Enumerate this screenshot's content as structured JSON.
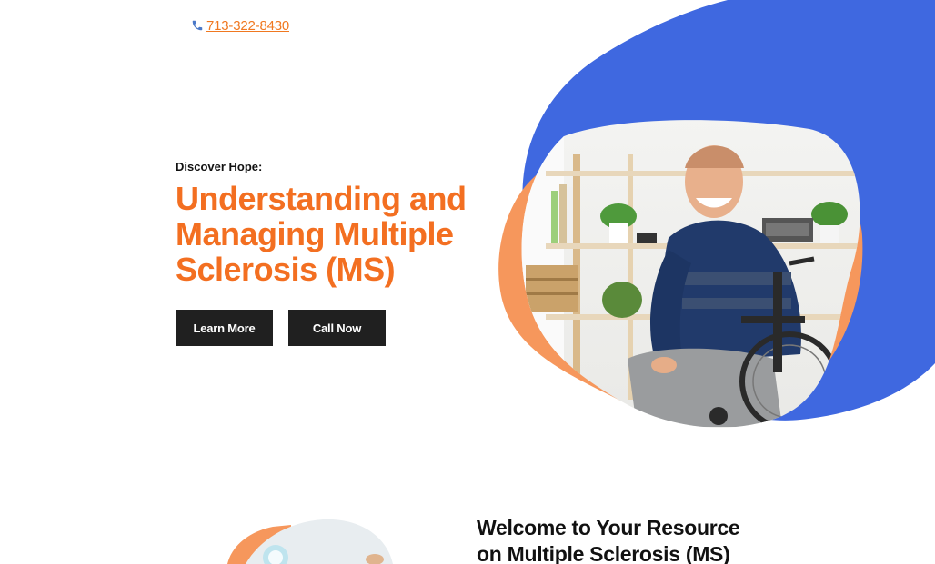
{
  "header": {
    "phone": "713-322-8430",
    "phone_icon": "phone-icon"
  },
  "hero": {
    "eyebrow": "Discover Hope:",
    "title_line1": "Understanding and",
    "title_line2": "Managing Multiple",
    "title_line3": "Sclerosis (MS)",
    "buttons": {
      "learn_more": "Learn More",
      "call_now": "Call Now"
    },
    "image": "man-in-wheelchair-photo"
  },
  "welcome": {
    "title_line1": "Welcome to Your Resource",
    "title_line2": "on Multiple Sclerosis (MS)",
    "image": "clinic-photo"
  },
  "colors": {
    "accent_orange": "#f36f21",
    "blob_blue": "#3f68e0",
    "blob_orange": "#f6975c",
    "button_dark": "#202020"
  }
}
